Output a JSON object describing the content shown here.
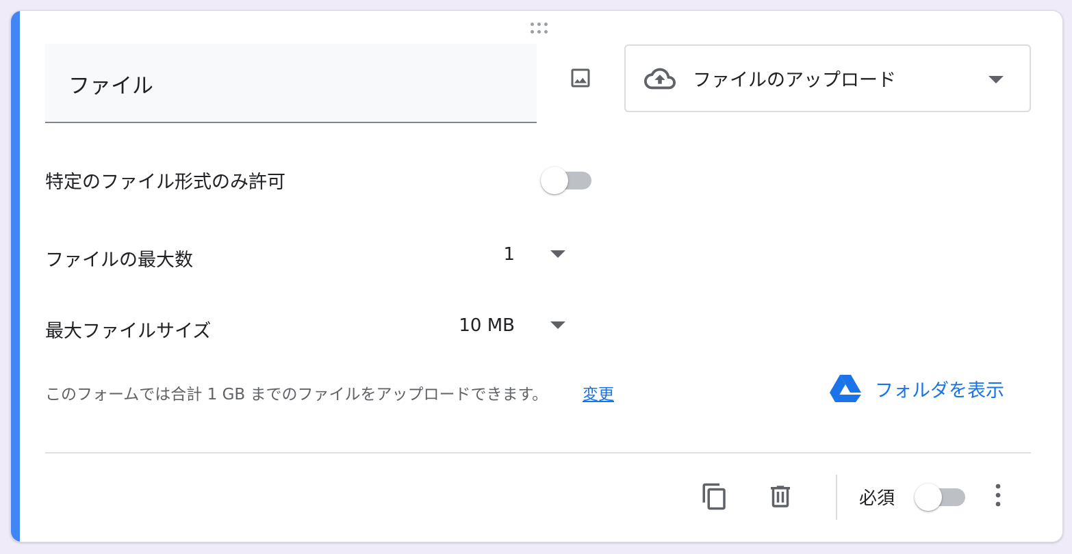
{
  "question": {
    "title": "ファイル",
    "type_label": "ファイルのアップロード"
  },
  "settings": {
    "specific_types_label": "特定のファイル形式のみ許可",
    "max_files_label": "ファイルの最大数",
    "max_files_value": "1",
    "max_size_label": "最大ファイルサイズ",
    "max_size_value": "10 MB",
    "quota_text": "このフォームでは合計 1 GB までのファイルをアップロードできます。",
    "change_link": "変更",
    "folder_link": "フォルダを表示"
  },
  "footer": {
    "required_label": "必須"
  },
  "icons": {
    "drag": "drag-handle-icon",
    "image": "image-icon",
    "cloud": "cloud-upload-icon",
    "drive": "google-drive-icon",
    "copy": "copy-icon",
    "delete": "trash-icon",
    "more": "more-vert-icon"
  },
  "colors": {
    "accent": "#4285f4",
    "link": "#1a73e8",
    "toggle_off_track": "#bdc1c6"
  }
}
